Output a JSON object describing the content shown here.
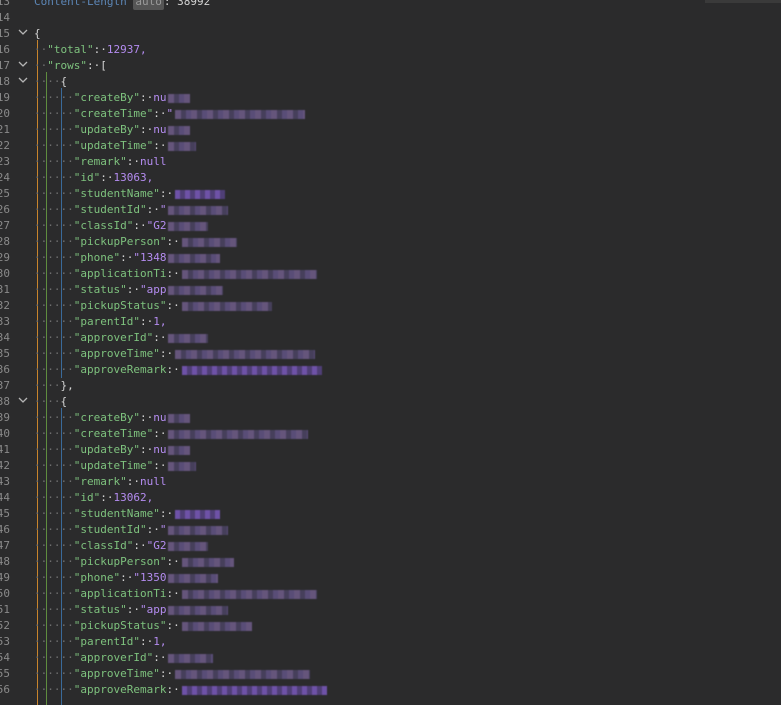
{
  "header": {
    "label": "Content-Length",
    "badge": "auto",
    "value": "38992"
  },
  "line_numbers": [
    "13",
    "14",
    "15",
    "16",
    "17",
    "18",
    "19",
    "20",
    "21",
    "22",
    "23",
    "24",
    "25",
    "26",
    "27",
    "28",
    "29",
    "30",
    "31",
    "32",
    "33",
    "34",
    "35",
    "36",
    "37",
    "38",
    "39",
    "40",
    "41",
    "42",
    "43",
    "44",
    "45",
    "46",
    "47",
    "48",
    "49",
    "50",
    "51",
    "52",
    "53",
    "54",
    "55",
    "56"
  ],
  "json": {
    "total_key": "\"total\"",
    "total_value": "12937,",
    "rows_key": "\"rows\"",
    "rows_open": "[",
    "records": [
      {
        "fields": [
          {
            "key": "\"createBy\"",
            "value": "nu"
          },
          {
            "key": "\"createTime\"",
            "value": "\""
          },
          {
            "key": "\"updateBy\"",
            "value": "nu"
          },
          {
            "key": "\"updateTime\"",
            "value": ""
          },
          {
            "key": "\"remark\"",
            "value": "null"
          },
          {
            "key": "\"id\"",
            "value": "13063,"
          },
          {
            "key": "\"studentName\"",
            "value": ""
          },
          {
            "key": "\"studentId\"",
            "value": "\""
          },
          {
            "key": "\"classId\"",
            "value": "\"G2"
          },
          {
            "key": "\"pickupPerson\"",
            "value": ""
          },
          {
            "key": "\"phone\"",
            "value": "\"1348"
          },
          {
            "key": "\"applicationTi",
            "value": ""
          },
          {
            "key": "\"status\"",
            "value": "\"app"
          },
          {
            "key": "\"pickupStatus\"",
            "value": ""
          },
          {
            "key": "\"parentId\"",
            "value": "1,"
          },
          {
            "key": "\"approverId\"",
            "value": ""
          },
          {
            "key": "\"approveTime\"",
            "value": ""
          },
          {
            "key": "\"approveRemark",
            "value": ""
          }
        ]
      },
      {
        "fields": [
          {
            "key": "\"createBy\"",
            "value": "nu"
          },
          {
            "key": "\"createTime\"",
            "value": ""
          },
          {
            "key": "\"updateBy\"",
            "value": "nu"
          },
          {
            "key": "\"updateTime\"",
            "value": ""
          },
          {
            "key": "\"remark\"",
            "value": "null"
          },
          {
            "key": "\"id\"",
            "value": "13062,"
          },
          {
            "key": "\"studentName\"",
            "value": ""
          },
          {
            "key": "\"studentId\"",
            "value": "\""
          },
          {
            "key": "\"classId\"",
            "value": "\"G2"
          },
          {
            "key": "\"pickupPerson\"",
            "value": ""
          },
          {
            "key": "\"phone\"",
            "value": "\"1350"
          },
          {
            "key": "\"applicationTi",
            "value": ""
          },
          {
            "key": "\"status\"",
            "value": "\"app"
          },
          {
            "key": "\"pickupStatus\"",
            "value": ""
          },
          {
            "key": "\"parentId\"",
            "value": "1,"
          },
          {
            "key": "\"approverId\"",
            "value": ""
          },
          {
            "key": "\"approveTime\"",
            "value": ""
          },
          {
            "key": "\"approveRemark",
            "value": ""
          }
        ]
      }
    ],
    "open_brace": "{",
    "close_brace_comma": "},"
  },
  "colors": {
    "background": "#2b2b2c",
    "key": "#7ec27e",
    "number": "#b48cf0",
    "guide": "#c8842c"
  },
  "icons": {
    "fold": "chevron-down-icon"
  }
}
